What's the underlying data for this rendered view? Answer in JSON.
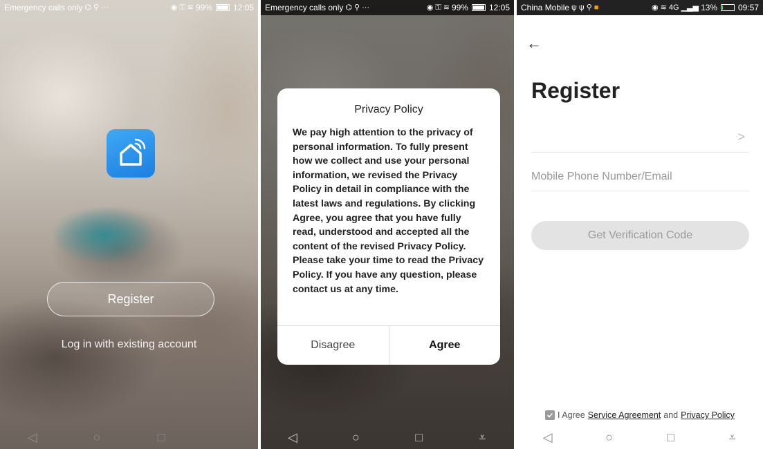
{
  "screen1": {
    "status": {
      "left_text": "Emergency calls only",
      "battery": "99%",
      "battery_level": 0.99,
      "time": "12:05"
    },
    "register_label": "Register",
    "login_label": "Log in with existing account"
  },
  "screen2": {
    "status": {
      "left_text": "Emergency calls only",
      "battery": "99%",
      "battery_level": 0.99,
      "time": "12:05"
    },
    "dialog": {
      "title": "Privacy Policy",
      "body": "We pay high attention to the privacy of personal information. To fully present how we collect and use your personal information, we revised the Privacy Policy in detail in compliance with the latest laws and regulations. By clicking Agree, you agree that you have fully read, understood and accepted all the content of the revised Privacy Policy. Please take your time to read the Privacy Policy. If you have any question, please contact us at any time.",
      "disagree_label": "Disagree",
      "agree_label": "Agree"
    }
  },
  "screen3": {
    "status": {
      "left_text": "China Mobile",
      "signal": "4G",
      "battery": "13%",
      "battery_level": 0.13,
      "time": "09:57"
    },
    "title": "Register",
    "country_value": "",
    "phone_placeholder": "Mobile Phone Number/Email",
    "verify_label": "Get Verification Code",
    "agree_prefix": "I Agree",
    "service_link": "Service Agreement",
    "and_text": "and",
    "privacy_link": "Privacy Policy",
    "agree_checked": true
  },
  "icons": {
    "back": "arrow-left-icon",
    "chevron": "chevron-right-icon",
    "nav_back": "triangle-back-icon",
    "nav_home": "circle-home-icon",
    "nav_recent": "square-recent-icon",
    "nav_menu": "pull-down-icon"
  }
}
